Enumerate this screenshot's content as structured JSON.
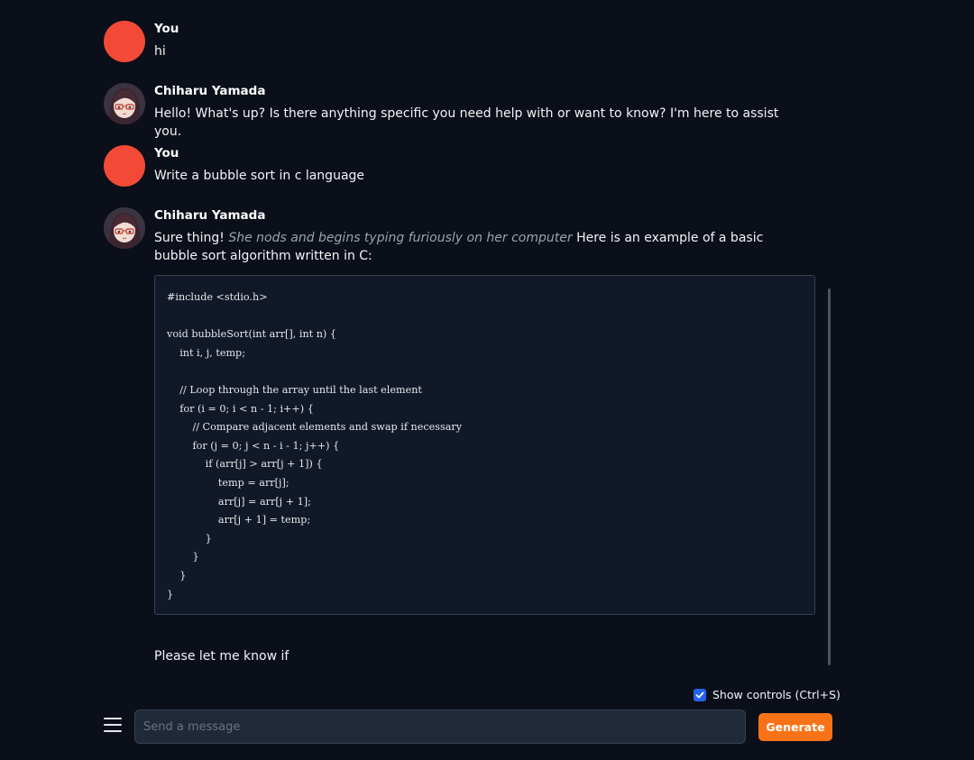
{
  "messages": [
    {
      "role": "user",
      "name": "You",
      "text": "hi"
    },
    {
      "role": "bot",
      "name": "Chiharu Yamada",
      "text": "Hello! What's up? Is there anything specific you need help with or want to know? I'm here to assist you."
    },
    {
      "role": "user",
      "name": "You",
      "text": "Write a bubble sort in c language"
    },
    {
      "role": "bot",
      "name": "Chiharu Yamada",
      "text_before": "Sure thing!",
      "action": "She nods and begins typing furiously on her computer",
      "text_after": "Here is an example of a basic bubble sort algorithm written in C:",
      "code": "#include <stdio.h>\n\nvoid bubbleSort(int arr[], int n) {\n    int i, j, temp;\n\n    // Loop through the array until the last element\n    for (i = 0; i < n - 1; i++) {\n        // Compare adjacent elements and swap if necessary\n        for (j = 0; j < n - i - 1; j++) {\n            if (arr[j] > arr[j + 1]) {\n                temp = arr[j];\n                arr[j] = arr[j + 1];\n                arr[j + 1] = temp;\n            }\n        }\n    }\n}",
      "tail_text": "Please let me know if"
    }
  ],
  "controls": {
    "show_controls_label": "Show controls (Ctrl+S)",
    "show_controls_checked": true
  },
  "composer": {
    "placeholder": "Send a message",
    "value": "",
    "generate_label": "Generate"
  },
  "icons": {
    "menu": "hamburger-menu-icon",
    "checkbox": "checkmark-icon"
  },
  "colors": {
    "background": "#0b0f19",
    "user_avatar": "#f34a37",
    "generate_button": "#f97316",
    "checkbox": "#2563eb",
    "code_background": "#111827"
  }
}
